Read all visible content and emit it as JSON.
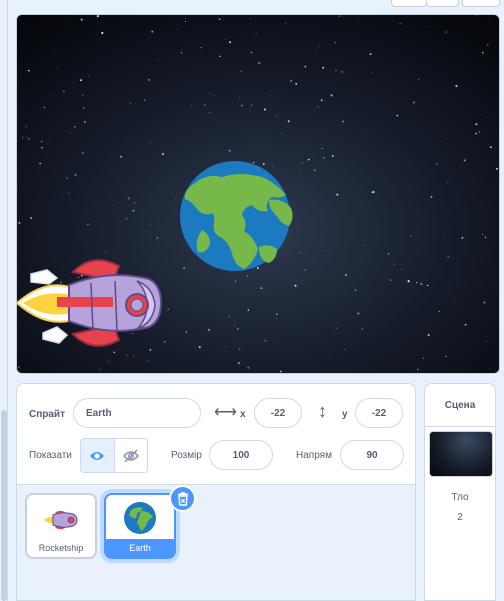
{
  "stage": {},
  "sprite_info": {
    "sprite_label": "Спрайт",
    "sprite_name": "Earth",
    "x_label": "x",
    "x_value": "-22",
    "y_label": "y",
    "y_value": "-22",
    "show_label": "Показати",
    "size_label": "Розмір",
    "size_value": "100",
    "direction_label": "Напрям",
    "direction_value": "90"
  },
  "sprites": [
    {
      "name": "Rocketship",
      "selected": false
    },
    {
      "name": "Earth",
      "selected": true
    }
  ],
  "stage_panel": {
    "title": "Сцена",
    "backdrops_label": "Тло",
    "backdrops_count": "2"
  },
  "colors": {
    "accent": "#4c97ff",
    "panel_bg": "#e9f1fc"
  }
}
